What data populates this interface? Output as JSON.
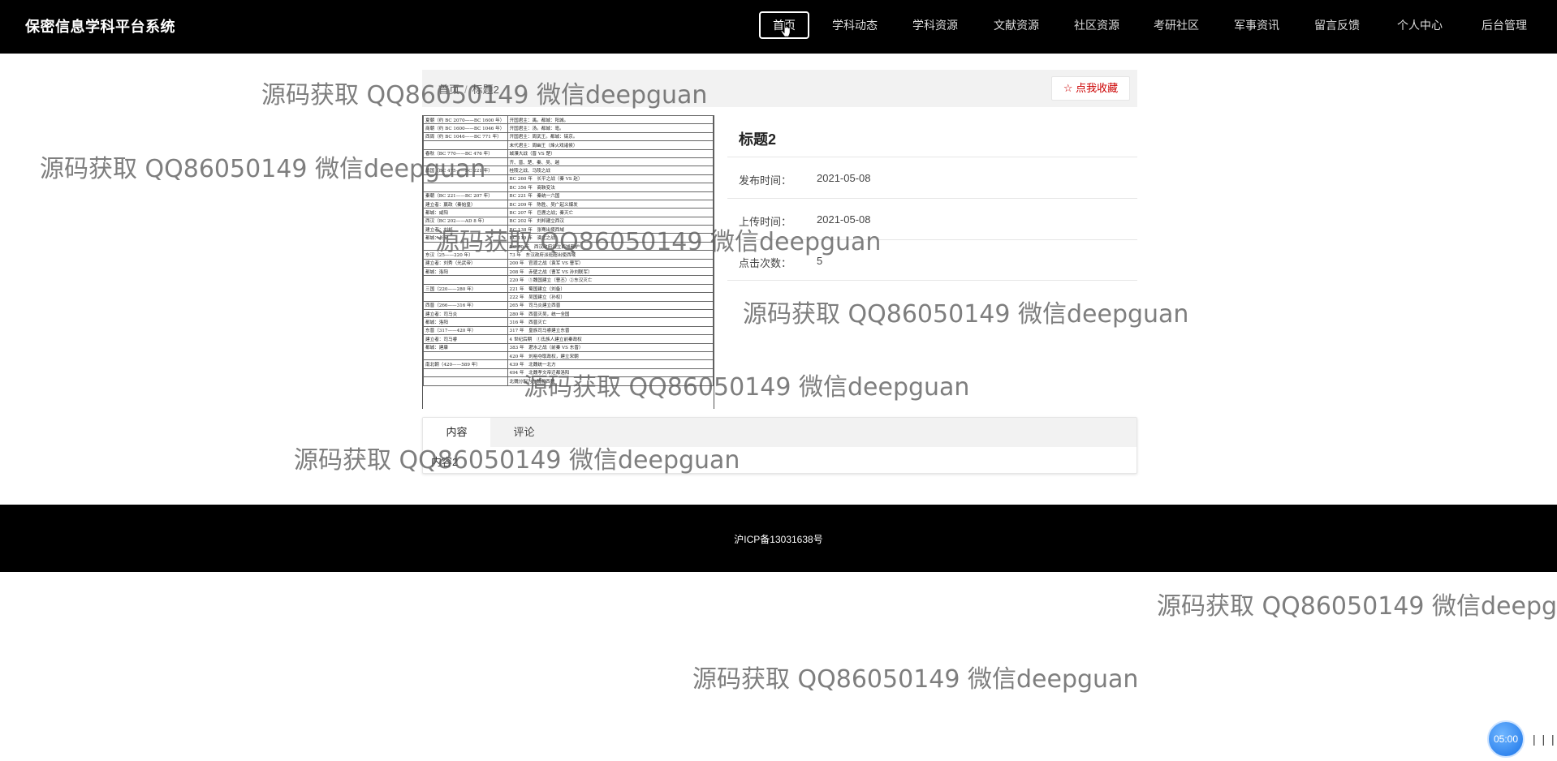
{
  "header": {
    "brand": "保密信息学科平台系统",
    "nav": [
      {
        "label": "首页",
        "active": true
      },
      {
        "label": "学科动态"
      },
      {
        "label": "学科资源"
      },
      {
        "label": "文献资源"
      },
      {
        "label": "社区资源"
      },
      {
        "label": "考研社区"
      },
      {
        "label": "军事资讯"
      },
      {
        "label": "留言反馈"
      },
      {
        "label": "个人中心"
      },
      {
        "label": "后台管理"
      }
    ]
  },
  "breadcrumb": {
    "home": "首页",
    "current": "标题2"
  },
  "favorite_label": "☆ 点我收藏",
  "detail": {
    "title": "标题2",
    "rows": [
      {
        "label": "发布时间：",
        "value": "2021-05-08"
      },
      {
        "label": "上传时间：",
        "value": "2021-05-08"
      },
      {
        "label": "点击次数：",
        "value": "5"
      }
    ]
  },
  "thumbnail_table": [
    [
      "夏朝（约 BC 2070——BC 1600 年）",
      "开国君主：禹。都城：阳城。"
    ],
    [
      "商朝（约 BC 1600——BC 1046 年）",
      "开国君主：汤。都城：亳。"
    ],
    [
      "西周（约 BC 1046——BC 771 年）",
      "开国君主：周武王。都城：镐京。"
    ],
    [
      "",
      "末代君主：周幽王（烽火戏诸侯）"
    ],
    [
      "春秋（BC 770——BC 476 年）",
      "城濮大战（晋 VS 楚）"
    ],
    [
      "",
      "齐、晋、楚、秦、吴、越"
    ],
    [
      "战国（BC 475——BC 221 年）",
      "桂陵之战、马陵之战"
    ],
    [
      "",
      "BC 260 年　长平之战（秦 VS 赵）"
    ],
    [
      "",
      "BC 356 年　商鞅变法"
    ],
    [
      "秦朝（BC 221——BC 207 年）",
      "BC 221 年　秦统一六国"
    ],
    [
      "建立者：嬴政（秦始皇）",
      "BC 209 年　陈胜、吴广起义爆发"
    ],
    [
      "都城：咸阳",
      "BC 207 年　巨鹿之战；秦灭亡"
    ],
    [
      "西汉（BC 202——AD 8 年）",
      "BC 202 年　刘邦建立西汉"
    ],
    [
      "建立者：刘邦",
      "BC 138 年　张骞出使西域"
    ],
    [
      "都城：长安",
      "BC 119 年　漠北之战"
    ],
    [
      "",
      "BC 60 年　西汉政府设立西域都护"
    ],
    [
      "东汉（25——220 年）",
      "73 年　东汉政府派班超出使西域"
    ],
    [
      "建立者：刘秀（光武帝）",
      "200 年　官渡之战（袁军 VS 曹军）"
    ],
    [
      "都城：洛阳",
      "208 年　赤壁之战（曹军 VS 孙刘联军）"
    ],
    [
      "",
      "220 年　①魏国建立（曹丕）②东汉灭亡"
    ],
    [
      "三国（220——280 年）",
      "221 年　蜀国建立（刘备）"
    ],
    [
      "",
      "222 年　吴国建立（孙权）"
    ],
    [
      "西晋（266——316 年）",
      "265 年　司马炎建立西晋"
    ],
    [
      "建立者：司马炎",
      "280 年　西晋灭吴，统一全国"
    ],
    [
      "都城：洛阳",
      "316 年　西晋灭亡"
    ],
    [
      "东晋（317——420 年）",
      "317 年　皇族司马睿建立东晋"
    ],
    [
      "建立者：司马睿",
      "4 世纪后期　①氐族人建立前秦政权"
    ],
    [
      "都城：建康",
      "383 年　淝水之战（前秦 VS 东晋）"
    ],
    [
      "",
      "420 年　刘裕夺取政权，建立宋朝"
    ],
    [
      "南北朝（420——589 年）",
      "439 年　北魏统一北方"
    ],
    [
      "",
      "494 年　北魏孝文帝迁都洛阳"
    ],
    [
      "",
      "北魏分裂为东魏和西魏"
    ]
  ],
  "tabs": [
    {
      "label": "内容",
      "active": true
    },
    {
      "label": "评论"
    }
  ],
  "tab_content": "内容2",
  "footer": {
    "icp": "沪ICP备13031638号"
  },
  "watermark_text": "源码获取 QQ86050149 微信deepguan",
  "timer": "05:00",
  "pause_glyph": "| | |"
}
